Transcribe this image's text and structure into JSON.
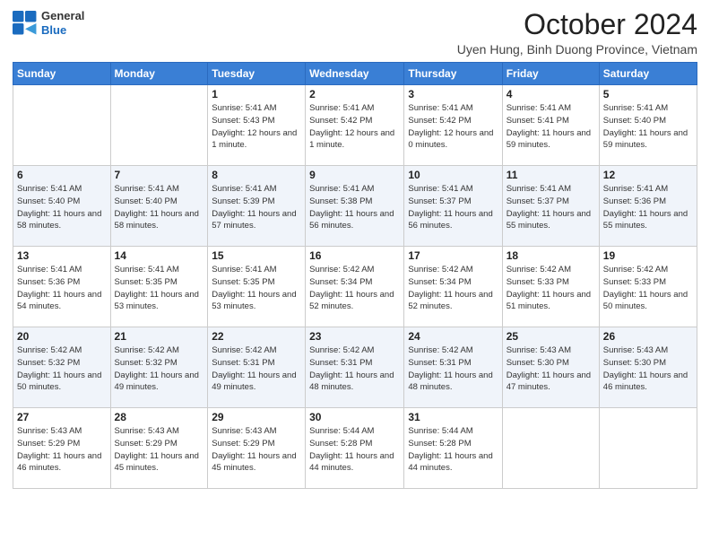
{
  "header": {
    "logo": {
      "general": "General",
      "blue": "Blue"
    },
    "title": "October 2024",
    "subtitle": "Uyen Hung, Binh Duong Province, Vietnam"
  },
  "weekdays": [
    "Sunday",
    "Monday",
    "Tuesday",
    "Wednesday",
    "Thursday",
    "Friday",
    "Saturday"
  ],
  "weeks": [
    [
      {
        "day": "",
        "info": ""
      },
      {
        "day": "",
        "info": ""
      },
      {
        "day": "1",
        "info": "Sunrise: 5:41 AM\nSunset: 5:43 PM\nDaylight: 12 hours and 1 minute."
      },
      {
        "day": "2",
        "info": "Sunrise: 5:41 AM\nSunset: 5:42 PM\nDaylight: 12 hours and 1 minute."
      },
      {
        "day": "3",
        "info": "Sunrise: 5:41 AM\nSunset: 5:42 PM\nDaylight: 12 hours and 0 minutes."
      },
      {
        "day": "4",
        "info": "Sunrise: 5:41 AM\nSunset: 5:41 PM\nDaylight: 11 hours and 59 minutes."
      },
      {
        "day": "5",
        "info": "Sunrise: 5:41 AM\nSunset: 5:40 PM\nDaylight: 11 hours and 59 minutes."
      }
    ],
    [
      {
        "day": "6",
        "info": "Sunrise: 5:41 AM\nSunset: 5:40 PM\nDaylight: 11 hours and 58 minutes."
      },
      {
        "day": "7",
        "info": "Sunrise: 5:41 AM\nSunset: 5:40 PM\nDaylight: 11 hours and 58 minutes."
      },
      {
        "day": "8",
        "info": "Sunrise: 5:41 AM\nSunset: 5:39 PM\nDaylight: 11 hours and 57 minutes."
      },
      {
        "day": "9",
        "info": "Sunrise: 5:41 AM\nSunset: 5:38 PM\nDaylight: 11 hours and 56 minutes."
      },
      {
        "day": "10",
        "info": "Sunrise: 5:41 AM\nSunset: 5:37 PM\nDaylight: 11 hours and 56 minutes."
      },
      {
        "day": "11",
        "info": "Sunrise: 5:41 AM\nSunset: 5:37 PM\nDaylight: 11 hours and 55 minutes."
      },
      {
        "day": "12",
        "info": "Sunrise: 5:41 AM\nSunset: 5:36 PM\nDaylight: 11 hours and 55 minutes."
      }
    ],
    [
      {
        "day": "13",
        "info": "Sunrise: 5:41 AM\nSunset: 5:36 PM\nDaylight: 11 hours and 54 minutes."
      },
      {
        "day": "14",
        "info": "Sunrise: 5:41 AM\nSunset: 5:35 PM\nDaylight: 11 hours and 53 minutes."
      },
      {
        "day": "15",
        "info": "Sunrise: 5:41 AM\nSunset: 5:35 PM\nDaylight: 11 hours and 53 minutes."
      },
      {
        "day": "16",
        "info": "Sunrise: 5:42 AM\nSunset: 5:34 PM\nDaylight: 11 hours and 52 minutes."
      },
      {
        "day": "17",
        "info": "Sunrise: 5:42 AM\nSunset: 5:34 PM\nDaylight: 11 hours and 52 minutes."
      },
      {
        "day": "18",
        "info": "Sunrise: 5:42 AM\nSunset: 5:33 PM\nDaylight: 11 hours and 51 minutes."
      },
      {
        "day": "19",
        "info": "Sunrise: 5:42 AM\nSunset: 5:33 PM\nDaylight: 11 hours and 50 minutes."
      }
    ],
    [
      {
        "day": "20",
        "info": "Sunrise: 5:42 AM\nSunset: 5:32 PM\nDaylight: 11 hours and 50 minutes."
      },
      {
        "day": "21",
        "info": "Sunrise: 5:42 AM\nSunset: 5:32 PM\nDaylight: 11 hours and 49 minutes."
      },
      {
        "day": "22",
        "info": "Sunrise: 5:42 AM\nSunset: 5:31 PM\nDaylight: 11 hours and 49 minutes."
      },
      {
        "day": "23",
        "info": "Sunrise: 5:42 AM\nSunset: 5:31 PM\nDaylight: 11 hours and 48 minutes."
      },
      {
        "day": "24",
        "info": "Sunrise: 5:42 AM\nSunset: 5:31 PM\nDaylight: 11 hours and 48 minutes."
      },
      {
        "day": "25",
        "info": "Sunrise: 5:43 AM\nSunset: 5:30 PM\nDaylight: 11 hours and 47 minutes."
      },
      {
        "day": "26",
        "info": "Sunrise: 5:43 AM\nSunset: 5:30 PM\nDaylight: 11 hours and 46 minutes."
      }
    ],
    [
      {
        "day": "27",
        "info": "Sunrise: 5:43 AM\nSunset: 5:29 PM\nDaylight: 11 hours and 46 minutes."
      },
      {
        "day": "28",
        "info": "Sunrise: 5:43 AM\nSunset: 5:29 PM\nDaylight: 11 hours and 45 minutes."
      },
      {
        "day": "29",
        "info": "Sunrise: 5:43 AM\nSunset: 5:29 PM\nDaylight: 11 hours and 45 minutes."
      },
      {
        "day": "30",
        "info": "Sunrise: 5:44 AM\nSunset: 5:28 PM\nDaylight: 11 hours and 44 minutes."
      },
      {
        "day": "31",
        "info": "Sunrise: 5:44 AM\nSunset: 5:28 PM\nDaylight: 11 hours and 44 minutes."
      },
      {
        "day": "",
        "info": ""
      },
      {
        "day": "",
        "info": ""
      }
    ]
  ]
}
